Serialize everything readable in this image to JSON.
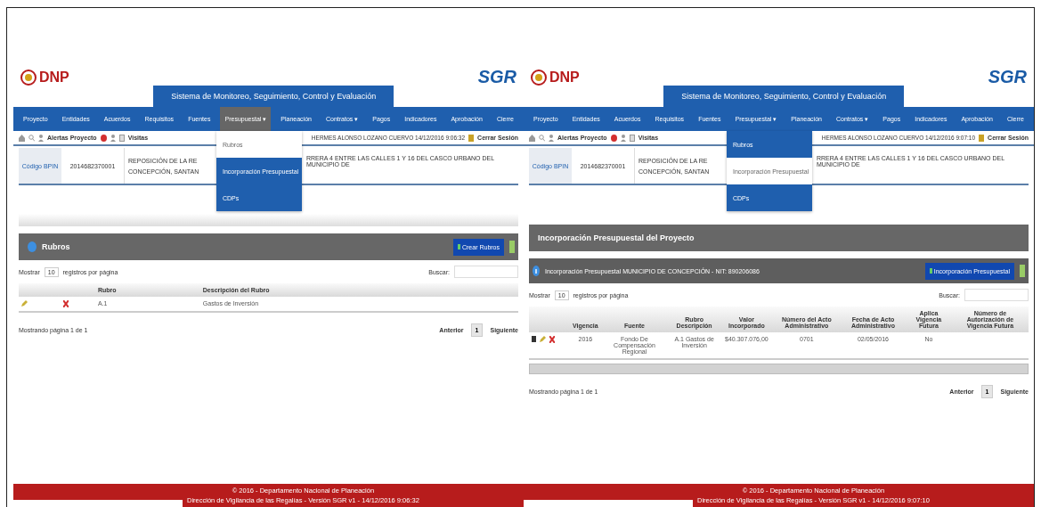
{
  "panels": [
    {
      "logo_left": "DNP",
      "logo_right": "SGR",
      "system_title": "Sistema de Monitoreo, Seguimiento, Control y Evaluación",
      "nav": [
        {
          "label": "Proyecto",
          "selected": false
        },
        {
          "label": "Entidades",
          "selected": false
        },
        {
          "label": "Acuerdos",
          "selected": false
        },
        {
          "label": "Requisitos",
          "selected": false
        },
        {
          "label": "Fuentes",
          "selected": false
        },
        {
          "label": "Presupuestal ▾",
          "selected": true
        },
        {
          "label": "Planeación",
          "selected": false
        },
        {
          "label": "Contratos ▾",
          "selected": false
        },
        {
          "label": "Pagos",
          "selected": false
        },
        {
          "label": "Indicadores",
          "selected": false
        },
        {
          "label": "Aprobación",
          "selected": false
        },
        {
          "label": "Cierre",
          "selected": false
        }
      ],
      "dropdown": [
        {
          "label": "Rubros",
          "selected": true
        },
        {
          "label": "Incorporación Presupuestal",
          "selected": false
        },
        {
          "label": "CDPs",
          "selected": false
        }
      ],
      "toolbar": {
        "alerts": "Alertas Proyecto",
        "visits": "Visitas",
        "user": "HERMES ALONSO LOZANO CUERVO 14/12/2016 9:06:32",
        "logout": "Cerrar Sesión"
      },
      "project": {
        "bpin_label": "Código BPIN",
        "bpin": "2014682370001",
        "name_left": [
          "REPOSICIÓN DE LA RE",
          "CONCEPCIÓN, SANTAN"
        ],
        "name_right": "RRERA 4 ENTRE LAS CALLES 1 Y 16 DEL CASCO URBANO DEL MUNICIPIO DE"
      },
      "section": {
        "title": "Rubros",
        "button": "Crear Rubros",
        "length_label": "Mostrar",
        "length_value": "10",
        "length_suffix": "registros por página",
        "search_label": "Buscar:",
        "columns": [
          "Rubro",
          "Descripción del Rubro"
        ],
        "rows": [
          [
            "A.1",
            "Gastos de Inversión"
          ]
        ],
        "info": "Mostrando página 1 de 1",
        "prev": "Anterior",
        "pages": [
          {
            "label": "1",
            "selected": true
          }
        ],
        "next": "Siguiente"
      },
      "footer": [
        "© 2016 - Departamento Nacional de Planeación",
        "Dirección de Vigilancia de las Regalías - Versión SGR v1 - 14/12/2016 9:06:32"
      ]
    },
    {
      "logo_left": "DNP",
      "logo_right": "SGR",
      "system_title": "Sistema de Monitoreo, Seguimiento, Control y Evaluación",
      "nav": [
        {
          "label": "Proyecto",
          "selected": false
        },
        {
          "label": "Entidades",
          "selected": false
        },
        {
          "label": "Acuerdos",
          "selected": false
        },
        {
          "label": "Requisitos",
          "selected": false
        },
        {
          "label": "Fuentes",
          "selected": false
        },
        {
          "label": "Presupuestal ▾",
          "selected": false
        },
        {
          "label": "Planeación",
          "selected": false
        },
        {
          "label": "Contratos ▾",
          "selected": false
        },
        {
          "label": "Pagos",
          "selected": false
        },
        {
          "label": "Indicadores",
          "selected": false
        },
        {
          "label": "Aprobación",
          "selected": false
        },
        {
          "label": "Cierre",
          "selected": false
        }
      ],
      "dropdown": [
        {
          "label": "Rubros",
          "selected": false
        },
        {
          "label": "Incorporación Presupuestal",
          "selected": true
        },
        {
          "label": "CDPs",
          "selected": false
        }
      ],
      "toolbar": {
        "alerts": "Alertas Proyecto",
        "visits": "Visitas",
        "user": "HERMES ALONSO LOZANO CUERVO 14/12/2016 9:07:10",
        "logout": "Cerrar Sesión"
      },
      "project": {
        "bpin_label": "Código BPIN",
        "bpin": "2014682370001",
        "name_left": [
          "REPOSICIÓN DE LA RE",
          "CONCEPCIÓN, SANTAN"
        ],
        "name_right": "RRERA 4 ENTRE LAS CALLES 1 Y 16 DEL CASCO URBANO DEL MUNICIPIO DE"
      },
      "section": {
        "title": "Incorporación Presupuestal del Proyecto",
        "info_bar": {
          "text": "Incorporación Presupuestal MUNICIPIO DE CONCEPCIÓN - NIT: 890206086",
          "button": "Incorporación Presupuestal"
        },
        "length_label": "Mostrar",
        "length_value": "10",
        "length_suffix": "registros por página",
        "search_label": "Buscar:",
        "columns": [
          "Vigencia",
          "Fuente",
          "Rubro Descripción",
          "Valor Incorporado",
          "Número del Acto Administrativo",
          "Fecha de Acto Administrativo",
          "Aplica Vigencia Futura",
          "Número de Autorización de Vigencia Futura"
        ],
        "rows": [
          [
            "2016",
            "Fondo De Compensación Regional",
            "A.1 Gastos de Inversión",
            "$40.307.076,00",
            "0701",
            "02/05/2016",
            "No",
            ""
          ]
        ],
        "info": "Mostrando página 1 de 1",
        "prev": "Anterior",
        "pages": [
          {
            "label": "1",
            "selected": true
          }
        ],
        "next": "Siguiente"
      },
      "footer": [
        "© 2016 - Departamento Nacional de Planeación",
        "Dirección de Vigilancia de las Regalías - Versión SGR v1 - 14/12/2016 9:07:10"
      ]
    }
  ]
}
